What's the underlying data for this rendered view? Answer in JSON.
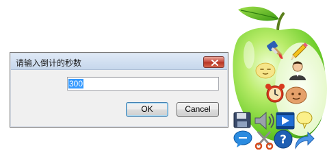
{
  "dialog": {
    "title": "请输入倒计的秒数",
    "input_value": "300",
    "ok_label": "OK",
    "cancel_label": "Cancel",
    "close_icon": "close-icon"
  },
  "launcher": {
    "icons": [
      "paint-brush-icon",
      "pencil-icon",
      "smiley-face-icon",
      "user-icon",
      "alarm-clock-icon",
      "smiley-face-icon",
      "save-icon",
      "speaker-icon",
      "video-icon",
      "speech-bubble-icon",
      "chat-icon",
      "scissors-icon",
      "help-icon",
      "redo-arrow-icon"
    ]
  }
}
